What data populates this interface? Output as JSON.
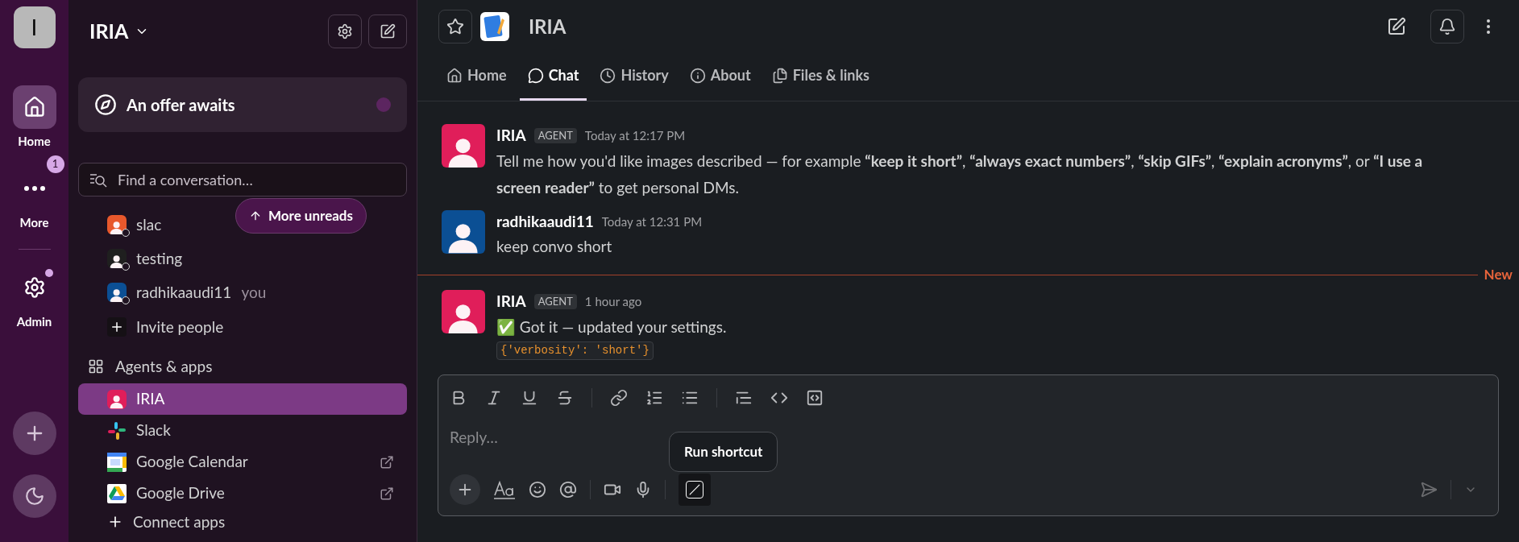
{
  "rail": {
    "workspace_initial": "I",
    "items": [
      {
        "label": "Home",
        "selected": true
      },
      {
        "label": "More",
        "selected": false,
        "badge": "1"
      },
      {
        "label": "Admin",
        "selected": false,
        "dot": true
      }
    ]
  },
  "sidebar": {
    "workspace": "IRIA",
    "offer": "An offer awaits",
    "search": {
      "placeholder": "Find a conversation…"
    },
    "more_unreads": "More unreads",
    "dms": [
      {
        "name": "slac",
        "color": "#e8582c"
      },
      {
        "name": "testing",
        "color": "#1f1f1f"
      },
      {
        "name": "radhikaaudi11",
        "color": "#0b4f94",
        "suffix": "you"
      }
    ],
    "invite": "Invite people",
    "apps_title": "Agents & apps",
    "apps": [
      {
        "name": "IRIA",
        "selected": true,
        "external": false
      },
      {
        "name": "Slack",
        "selected": false,
        "external": false
      },
      {
        "name": "Google Calendar",
        "selected": false,
        "external": true
      },
      {
        "name": "Google Drive",
        "selected": false,
        "external": true
      }
    ],
    "connect": "Connect apps"
  },
  "header": {
    "title": "IRIA"
  },
  "tabs": [
    {
      "label": "Home",
      "selected": false
    },
    {
      "label": "Chat",
      "selected": true
    },
    {
      "label": "History",
      "selected": false
    },
    {
      "label": "About",
      "selected": false
    },
    {
      "label": "Files & links",
      "selected": false
    }
  ],
  "messages": [
    {
      "kind": "message",
      "author": "IRIA",
      "badge": "AGENT",
      "time": "Today at 12:17 PM",
      "color": "#e01e5a",
      "text": "Tell me how you'd like images described — for example **“keep it short”**, **“always exact numbers”**, **“skip GIFs”**, **“explain acronyms”**, or **“I use a screen reader”** to get personal DMs."
    },
    {
      "kind": "message",
      "author": "radhikaaudi11",
      "time": "Today at 12:31 PM",
      "color": "#0b4f94",
      "text": "keep convo short"
    },
    {
      "kind": "divider",
      "label": "New"
    },
    {
      "kind": "message",
      "author": "IRIA",
      "badge": "AGENT",
      "time": "1 hour ago",
      "color": "#e01e5a",
      "text": "✅ Got it — updated your settings.",
      "code": "{'verbosity': 'short'}"
    }
  ],
  "composer": {
    "placeholder": "Reply…",
    "tooltip": "Run shortcut"
  }
}
